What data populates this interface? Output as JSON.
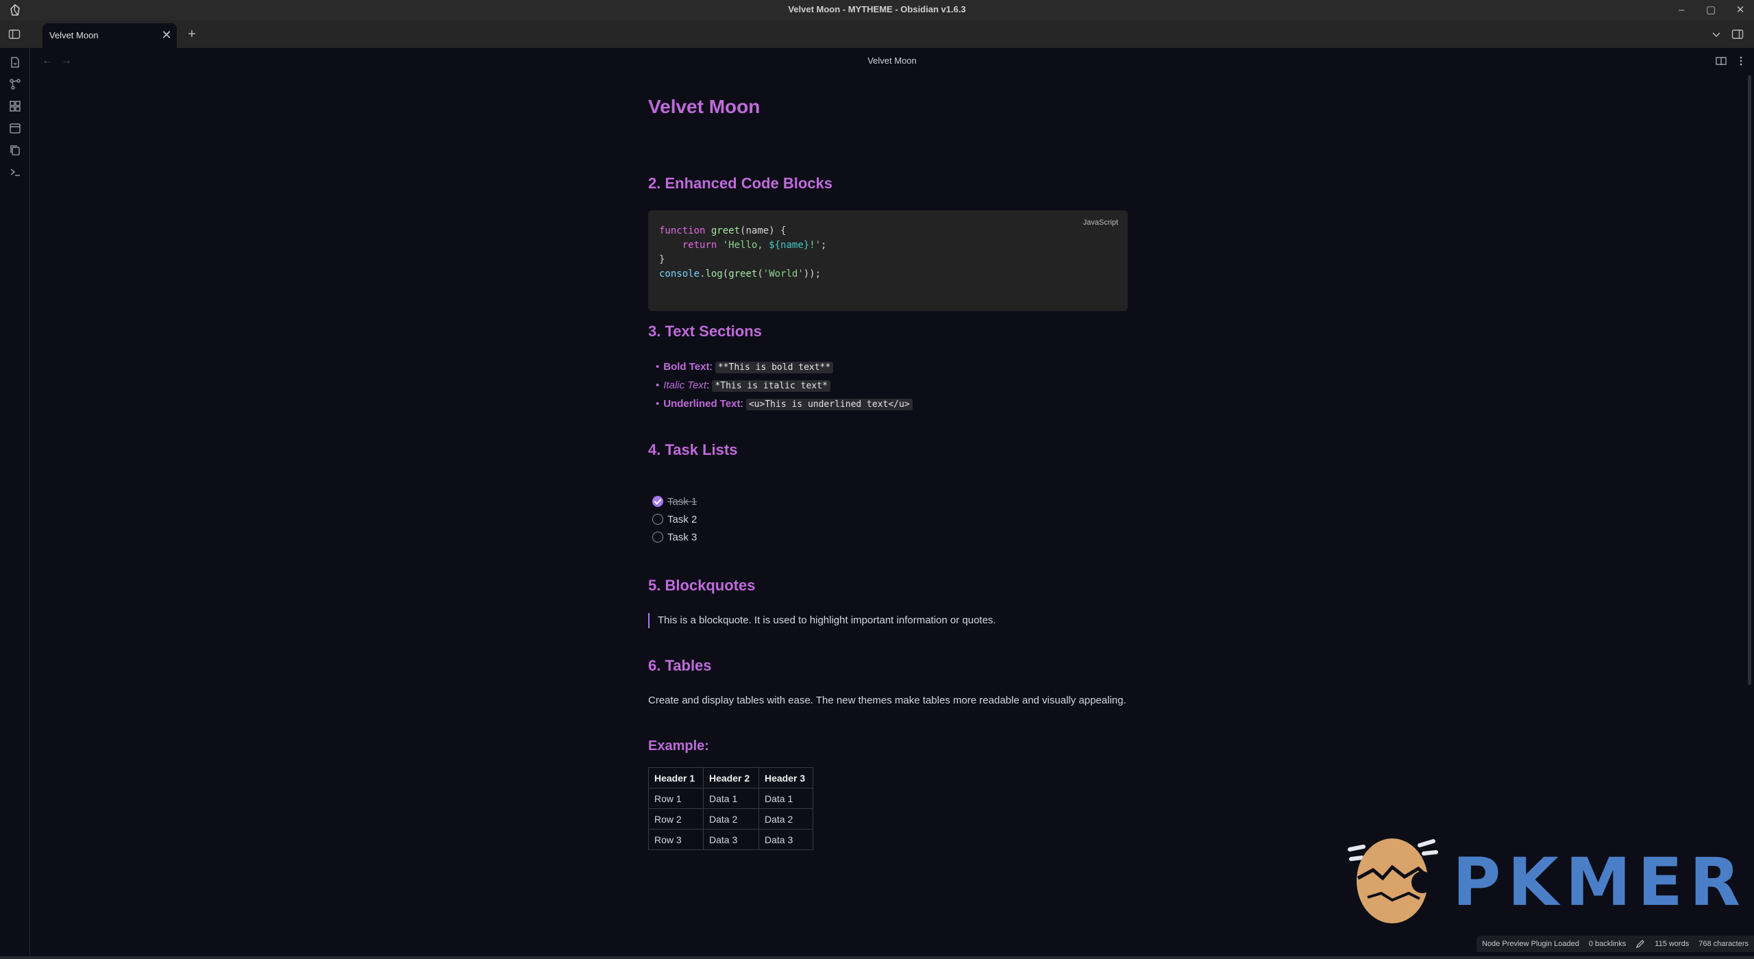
{
  "window": {
    "title": "Velvet Moon - MYTHEME - Obsidian v1.6.3",
    "minimize_glyph": "–",
    "maximize_glyph": "▢",
    "close_glyph": "✕"
  },
  "tabs": [
    {
      "label": "Velvet Moon",
      "close_glyph": "✕"
    }
  ],
  "new_tab_glyph": "+",
  "ribbon_icons": [
    "file-icon",
    "graph-icon",
    "grid-icon",
    "calendar-icon",
    "copy-icon",
    "terminal-icon"
  ],
  "view": {
    "title": "Velvet Moon",
    "back_glyph": "←",
    "forward_glyph": "→"
  },
  "note": {
    "title": "Velvet Moon",
    "sections": {
      "code": {
        "heading": "2. Enhanced Code Blocks",
        "language": "JavaScript",
        "line1": {
          "kw": "function",
          "fn": "greet",
          "rest": "(name) {"
        },
        "line2": {
          "kw": "return",
          "str_open": "'Hello, ",
          "tpl": "${name}",
          "str_close": "!'",
          "end": ";"
        },
        "line3": "}",
        "line4": {
          "obj": "console",
          "dot": ".",
          "method": "log",
          "p1": "(",
          "fn": "greet",
          "p2": "(",
          "str": "'World'",
          "p3": "));"
        }
      },
      "text": {
        "heading": "3. Text Sections",
        "items": [
          {
            "label": "Bold Text",
            "colon": ":",
            "code": "**This is bold text**"
          },
          {
            "label": "Italic Text",
            "colon": ":",
            "code": "*This is italic text*"
          },
          {
            "label": "Underlined Text",
            "colon": ":",
            "code": "<u>This is underlined text</u>"
          }
        ]
      },
      "tasks": {
        "heading": "4. Task Lists",
        "items": [
          {
            "label": "Task 1",
            "done": true
          },
          {
            "label": "Task 2",
            "done": false
          },
          {
            "label": "Task 3",
            "done": false
          }
        ]
      },
      "blockquote": {
        "heading": "5. Blockquotes",
        "text": "This is a blockquote. It is used to highlight important information or quotes."
      },
      "tables": {
        "heading": "6. Tables",
        "paragraph": "Create and display tables with ease. The new themes make tables more readable and visually appealing.",
        "example_heading": "Example:",
        "headers": [
          "Header 1",
          "Header 2",
          "Header 3"
        ],
        "rows": [
          [
            "Row 1",
            "Data 1",
            "Data 1"
          ],
          [
            "Row 2",
            "Data 2",
            "Data 2"
          ],
          [
            "Row 3",
            "Data 3",
            "Data 3"
          ]
        ]
      }
    }
  },
  "watermark": {
    "text": "PKMER"
  },
  "status": {
    "plugin": "Node Preview Plugin Loaded",
    "backlinks": "0 backlinks",
    "words": "115 words",
    "characters": "768 characters"
  },
  "colors": {
    "accent": "#c06bdb",
    "checkbox": "#a57bf7",
    "background": "#0c0d17"
  }
}
